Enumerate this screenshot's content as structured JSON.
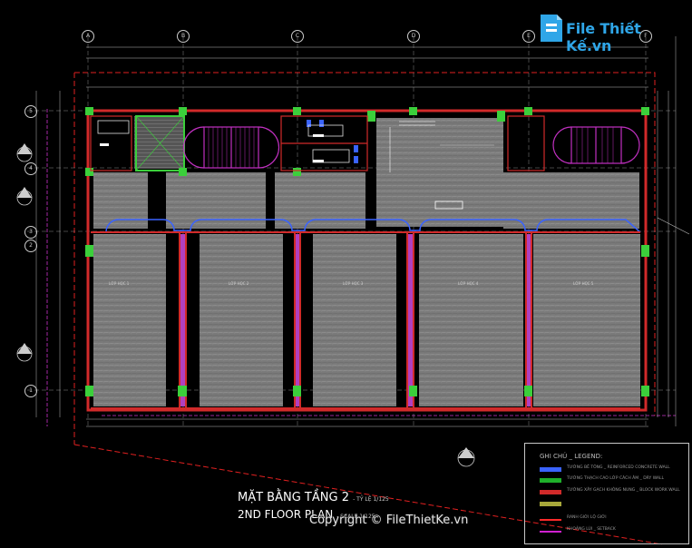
{
  "drawing": {
    "title_vn": "MẶT BẰNG TẦNG 2",
    "title_vn_suffix": "- TỶ LỆ 1/125",
    "title_en": "2ND FLOOR PLAN",
    "title_en_suffix": "- SCALE 1/125"
  },
  "grid": {
    "columns": [
      "A",
      "B",
      "C",
      "D",
      "E",
      "F"
    ],
    "rows": [
      "5",
      "4",
      "3",
      "2",
      "1"
    ]
  },
  "rooms": [
    {
      "label": "LỚP HỌC 1"
    },
    {
      "label": "LỚP HỌC 2"
    },
    {
      "label": "LỚP HỌC 3"
    },
    {
      "label": "LỚP HỌC 4"
    },
    {
      "label": "LỚP HỌC 5"
    }
  ],
  "legend": {
    "title": "GHI CHÚ _ LEGEND:",
    "items": [
      {
        "label": "TƯỜNG BÊ TÔNG _ REINFORCED CONCRETE WALL",
        "color": "#3a63ff"
      },
      {
        "label": "TƯỜNG THẠCH CAO LỚP CÁCH ÂM _ DRY WALL",
        "color": "#1fb02a"
      },
      {
        "label": "TƯỜNG XÂY GẠCH KHÔNG NUNG _ BLOCK WORK WALL",
        "color": "#d12a2a"
      },
      {
        "label": "",
        "color": "#a8a83a"
      },
      {
        "label": "RANH GIỚI LỘ GIỚI",
        "color": "#ff2a2a"
      },
      {
        "label": "KHOẢNG LÙI _ SETBACK",
        "color": "#d020d0"
      }
    ]
  },
  "logo": {
    "text": "File Thiết Kế.vn"
  },
  "copyright": {
    "text": "Copyright © FileThietKe.vn"
  },
  "colors": {
    "background": "#000000",
    "room_fill": "#7d7d7d",
    "wall_red": "#d12a2a",
    "wall_blue": "#3a63ff",
    "wall_magenta": "#c030c0",
    "accent_green": "#3bcf3b",
    "logo_blue": "#2fa6e8"
  }
}
